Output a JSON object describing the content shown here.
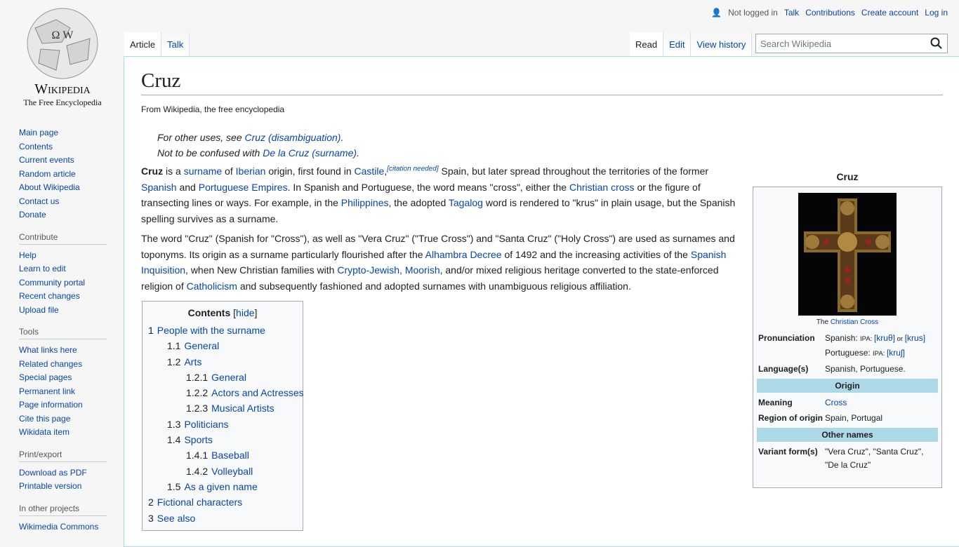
{
  "logo": {
    "wordmark": "Wikipedia",
    "tagline": "The Free Encyclopedia"
  },
  "personal": {
    "not_logged": "Not logged in",
    "links": [
      "Talk",
      "Contributions",
      "Create account",
      "Log in"
    ]
  },
  "tabs_left": [
    "Article",
    "Talk"
  ],
  "tabs_right": [
    "Read",
    "Edit",
    "View history"
  ],
  "search": {
    "placeholder": "Search Wikipedia"
  },
  "sidebar": [
    {
      "heading": "",
      "items": [
        "Main page",
        "Contents",
        "Current events",
        "Random article",
        "About Wikipedia",
        "Contact us",
        "Donate"
      ]
    },
    {
      "heading": "Contribute",
      "items": [
        "Help",
        "Learn to edit",
        "Community portal",
        "Recent changes",
        "Upload file"
      ]
    },
    {
      "heading": "Tools",
      "items": [
        "What links here",
        "Related changes",
        "Special pages",
        "Permanent link",
        "Page information",
        "Cite this page",
        "Wikidata item"
      ]
    },
    {
      "heading": "Print/export",
      "items": [
        "Download as PDF",
        "Printable version"
      ]
    },
    {
      "heading": "In other projects",
      "items": [
        "Wikimedia Commons"
      ]
    }
  ],
  "title": "Cruz",
  "tagline": "From Wikipedia, the free encyclopedia",
  "hatnotes": [
    [
      {
        "t": "For other uses, see "
      },
      {
        "t": "Cruz (disambiguation)",
        "l": 1
      },
      {
        "t": "."
      }
    ],
    [
      {
        "t": "Not to be confused with "
      },
      {
        "t": "De la Cruz (surname)",
        "l": 1
      },
      {
        "t": "."
      }
    ]
  ],
  "paragraphs": [
    [
      {
        "t": "Cruz",
        "b": 1
      },
      {
        "t": " is a "
      },
      {
        "t": "surname",
        "l": 1
      },
      {
        "t": " of "
      },
      {
        "t": "Iberian",
        "l": 1
      },
      {
        "t": " origin, first found in "
      },
      {
        "t": "Castile",
        "l": 1
      },
      {
        "t": ","
      },
      {
        "t": "[citation needed]",
        "s": 1
      },
      {
        "t": " Spain, but later spread throughout the territories of the former "
      },
      {
        "t": "Spanish",
        "l": 1
      },
      {
        "t": " and "
      },
      {
        "t": "Portuguese Empires",
        "l": 1
      },
      {
        "t": ". In Spanish and Portuguese, the word means \"cross\", either the "
      },
      {
        "t": "Christian cross",
        "l": 1
      },
      {
        "t": " or the figure of transecting lines or ways. For example, in the "
      },
      {
        "t": "Philippines",
        "l": 1
      },
      {
        "t": ", the adopted "
      },
      {
        "t": "Tagalog",
        "l": 1
      },
      {
        "t": " word is rendered to \"krus\" in plain usage, but the Spanish spelling survives as a surname."
      }
    ],
    [
      {
        "t": "The word \"Cruz\" (Spanish for \"Cross\"), as well as \"Vera Cruz\" (\"True Cross\") and \"Santa Cruz\" (\"Holy Cross\") are used as surnames and toponyms. Its origin as a surname particularly flourished after the "
      },
      {
        "t": "Alhambra Decree",
        "l": 1
      },
      {
        "t": " of 1492 and the increasing activities of the "
      },
      {
        "t": "Spanish Inquisition",
        "l": 1
      },
      {
        "t": ", when New Christian families with "
      },
      {
        "t": "Crypto-Jewish, Moorish",
        "l": 1
      },
      {
        "t": ", and/or mixed religious heritage converted to the state-enforced religion of "
      },
      {
        "t": "Catholicism",
        "l": 1
      },
      {
        "t": " and subsequently fashioned and adopted surnames with unambiguous religious affiliation."
      }
    ]
  ],
  "toc": {
    "title": "Contents",
    "hide": "hide",
    "items": [
      {
        "n": "1",
        "t": "People with the surname",
        "d": 0
      },
      {
        "n": "1.1",
        "t": "General",
        "d": 1
      },
      {
        "n": "1.2",
        "t": "Arts",
        "d": 1
      },
      {
        "n": "1.2.1",
        "t": "General",
        "d": 2
      },
      {
        "n": "1.2.2",
        "t": "Actors and Actresses",
        "d": 2
      },
      {
        "n": "1.2.3",
        "t": "Musical Artists",
        "d": 2
      },
      {
        "n": "1.3",
        "t": "Politicians",
        "d": 1
      },
      {
        "n": "1.4",
        "t": "Sports",
        "d": 1
      },
      {
        "n": "1.4.1",
        "t": "Baseball",
        "d": 2
      },
      {
        "n": "1.4.2",
        "t": "Volleyball",
        "d": 2
      },
      {
        "n": "1.5",
        "t": "As a given name",
        "d": 1
      },
      {
        "n": "2",
        "t": "Fictional characters",
        "d": 0
      },
      {
        "n": "3",
        "t": "See also",
        "d": 0
      }
    ]
  },
  "infobox": {
    "title": "Cruz",
    "caption_pre": "The ",
    "caption_link": "Christian Cross",
    "pron_label": "Pronunciation",
    "pron_es": "Spanish: ",
    "ipa": "IPA: ",
    "kru_th": "[kruθ]",
    "or": " or ",
    "krus": "[krus]",
    "pron_pt": "Portuguese: ",
    "kru_sh": "[kruʃ]",
    "lang_label": "Language(s)",
    "lang": "Spanish, Portuguese.",
    "origin_header": "Origin",
    "meaning_label": "Meaning",
    "meaning": "Cross",
    "region_label": "Region of origin",
    "region": "Spain, Portugal",
    "other_header": "Other names",
    "variant_label": "Variant form(s)",
    "variant": "\"Vera Cruz\", \"Santa Cruz\", \"De la Cruz\""
  }
}
